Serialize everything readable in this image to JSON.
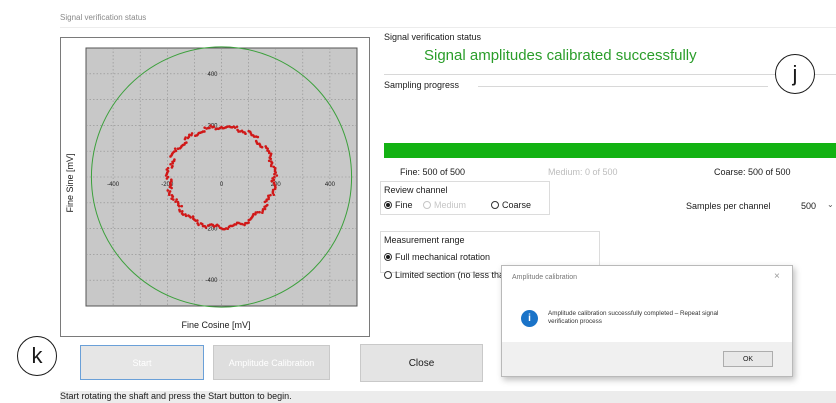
{
  "window": {
    "title": "Signal verification status"
  },
  "plot": {
    "xlabel": "Fine Cosine [mV]",
    "ylabel": "Fine Sine [mV]",
    "x_ticks": [
      "-400",
      "-200",
      "0",
      "200",
      "400"
    ],
    "y_ticks": [
      "400",
      "200",
      "0",
      "-200",
      "-400"
    ],
    "colors": {
      "background": "#c8c8c8",
      "inner_circle": "#d01818",
      "outer_circle": "#3ca03c",
      "grid": "#8e8e8e"
    }
  },
  "chart_data": {
    "type": "scatter",
    "xlabel": "Fine Cosine [mV]",
    "ylabel": "Fine Sine [mV]",
    "xlim": [
      -500,
      500
    ],
    "ylim": [
      -500,
      500
    ],
    "grid": true,
    "x_ticks": [
      -400,
      -200,
      0,
      200,
      400
    ],
    "y_ticks": [
      -400,
      -200,
      0,
      200,
      400
    ],
    "measured_radius": 200,
    "reference_circle_radius": 480
  },
  "status": {
    "label": "Signal verification status",
    "message": "Signal amplitudes calibrated successfully",
    "color": "#2a9d2a"
  },
  "sampling": {
    "label": "Sampling progress",
    "progress": 1.0,
    "bar_color": "#13b213",
    "fine": "Fine: 500 of 500",
    "medium": "Medium: 0 of 500",
    "coarse": "Coarse: 500 of 500"
  },
  "review": {
    "label": "Review channel",
    "options": [
      "Fine",
      "Medium",
      "Coarse"
    ],
    "selected": "Fine"
  },
  "samples": {
    "label": "Samples per channel",
    "value": "500"
  },
  "measurement": {
    "label": "Measurement range",
    "options": [
      "Full mechanical rotation",
      "Limited section (no less than 45 degrees)"
    ],
    "selected": "Full mechanical rotation"
  },
  "buttons": {
    "start": "Start",
    "amplitude": "Amplitude Calibration",
    "close": "Close"
  },
  "dialog": {
    "title": "Amplitude calibration",
    "message_line1": "Amplitude calibration successfully completed – Repeat signal",
    "message_line2": "verification process",
    "ok": "OK",
    "icon_color": "#1a73c8"
  },
  "callouts": {
    "j": "j",
    "k": "k"
  },
  "statusbar": {
    "text": "Start rotating the shaft and press the Start button to begin."
  }
}
